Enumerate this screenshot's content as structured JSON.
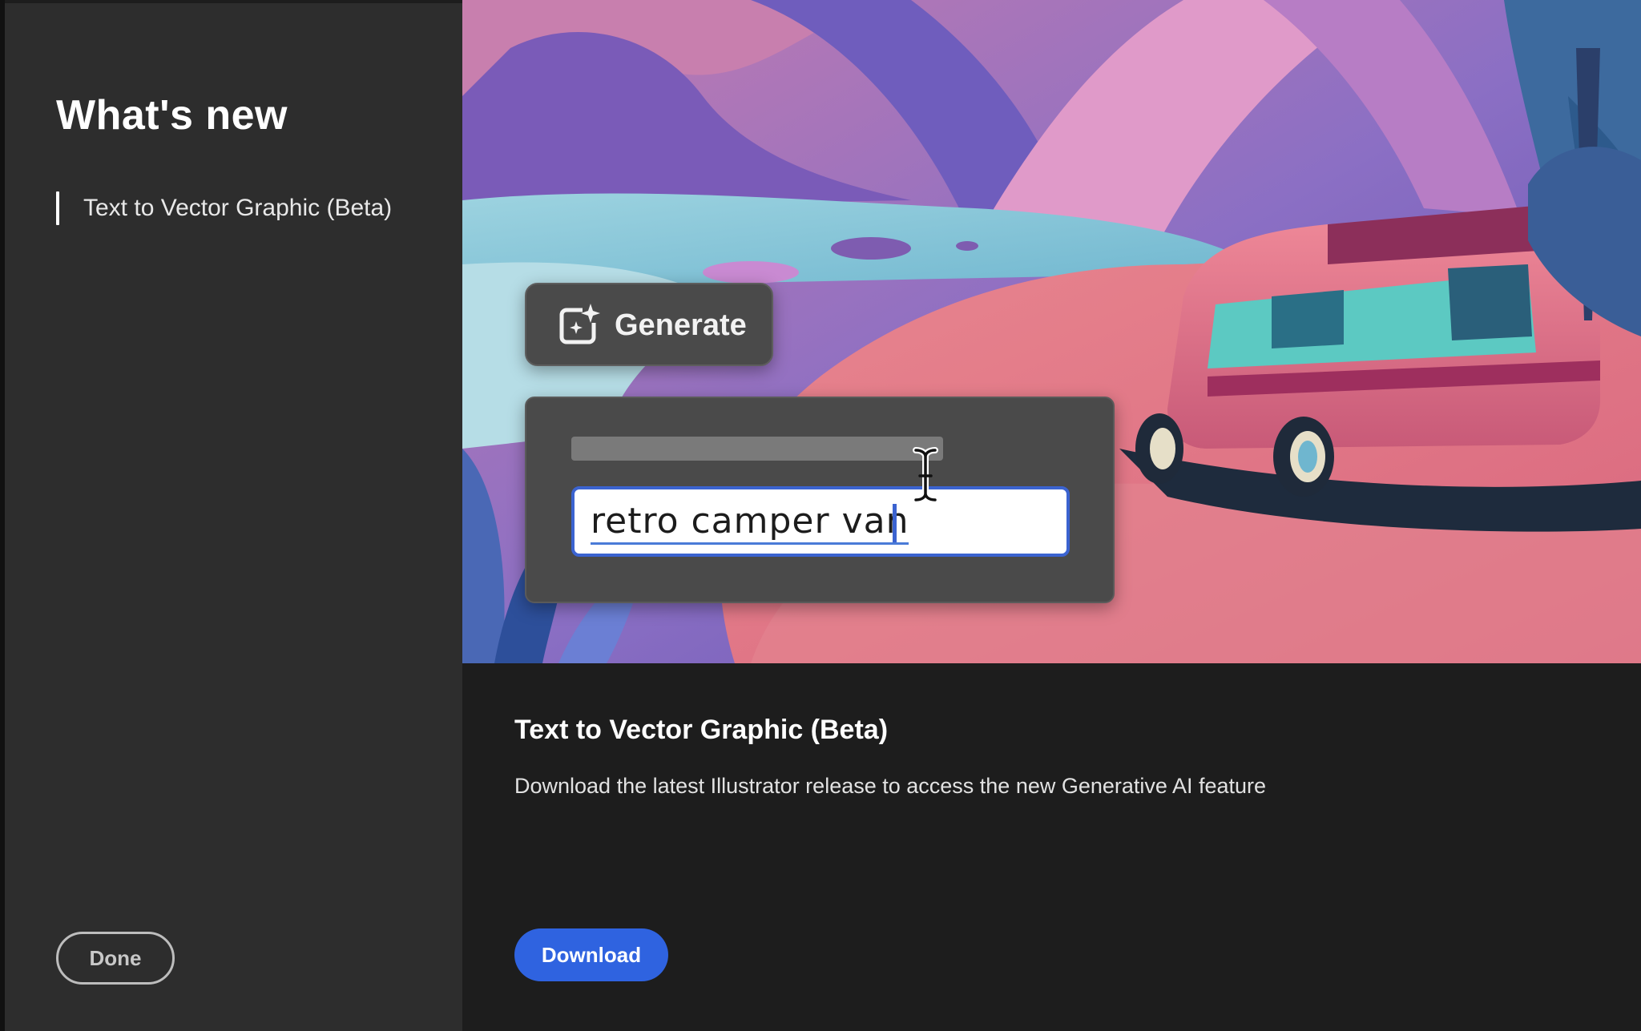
{
  "sidebar": {
    "title": "What's new",
    "items": [
      {
        "label": "Text to Vector Graphic (Beta)",
        "selected": true
      }
    ],
    "done_label": "Done"
  },
  "hero": {
    "generate_label": "Generate",
    "prompt_value": "retro camper van",
    "icons": [
      "generate-sparkle-icon",
      "text-cursor-icon"
    ]
  },
  "detail": {
    "title": "Text to Vector Graphic (Beta)",
    "description": "Download the latest Illustrator release to access the new Generative AI feature",
    "download_label": "Download"
  },
  "colors": {
    "sidebar_bg": "#2d2d2d",
    "main_bg": "#1d1d1d",
    "accent_blue": "#2f63e0",
    "input_border": "#3b63d0"
  }
}
